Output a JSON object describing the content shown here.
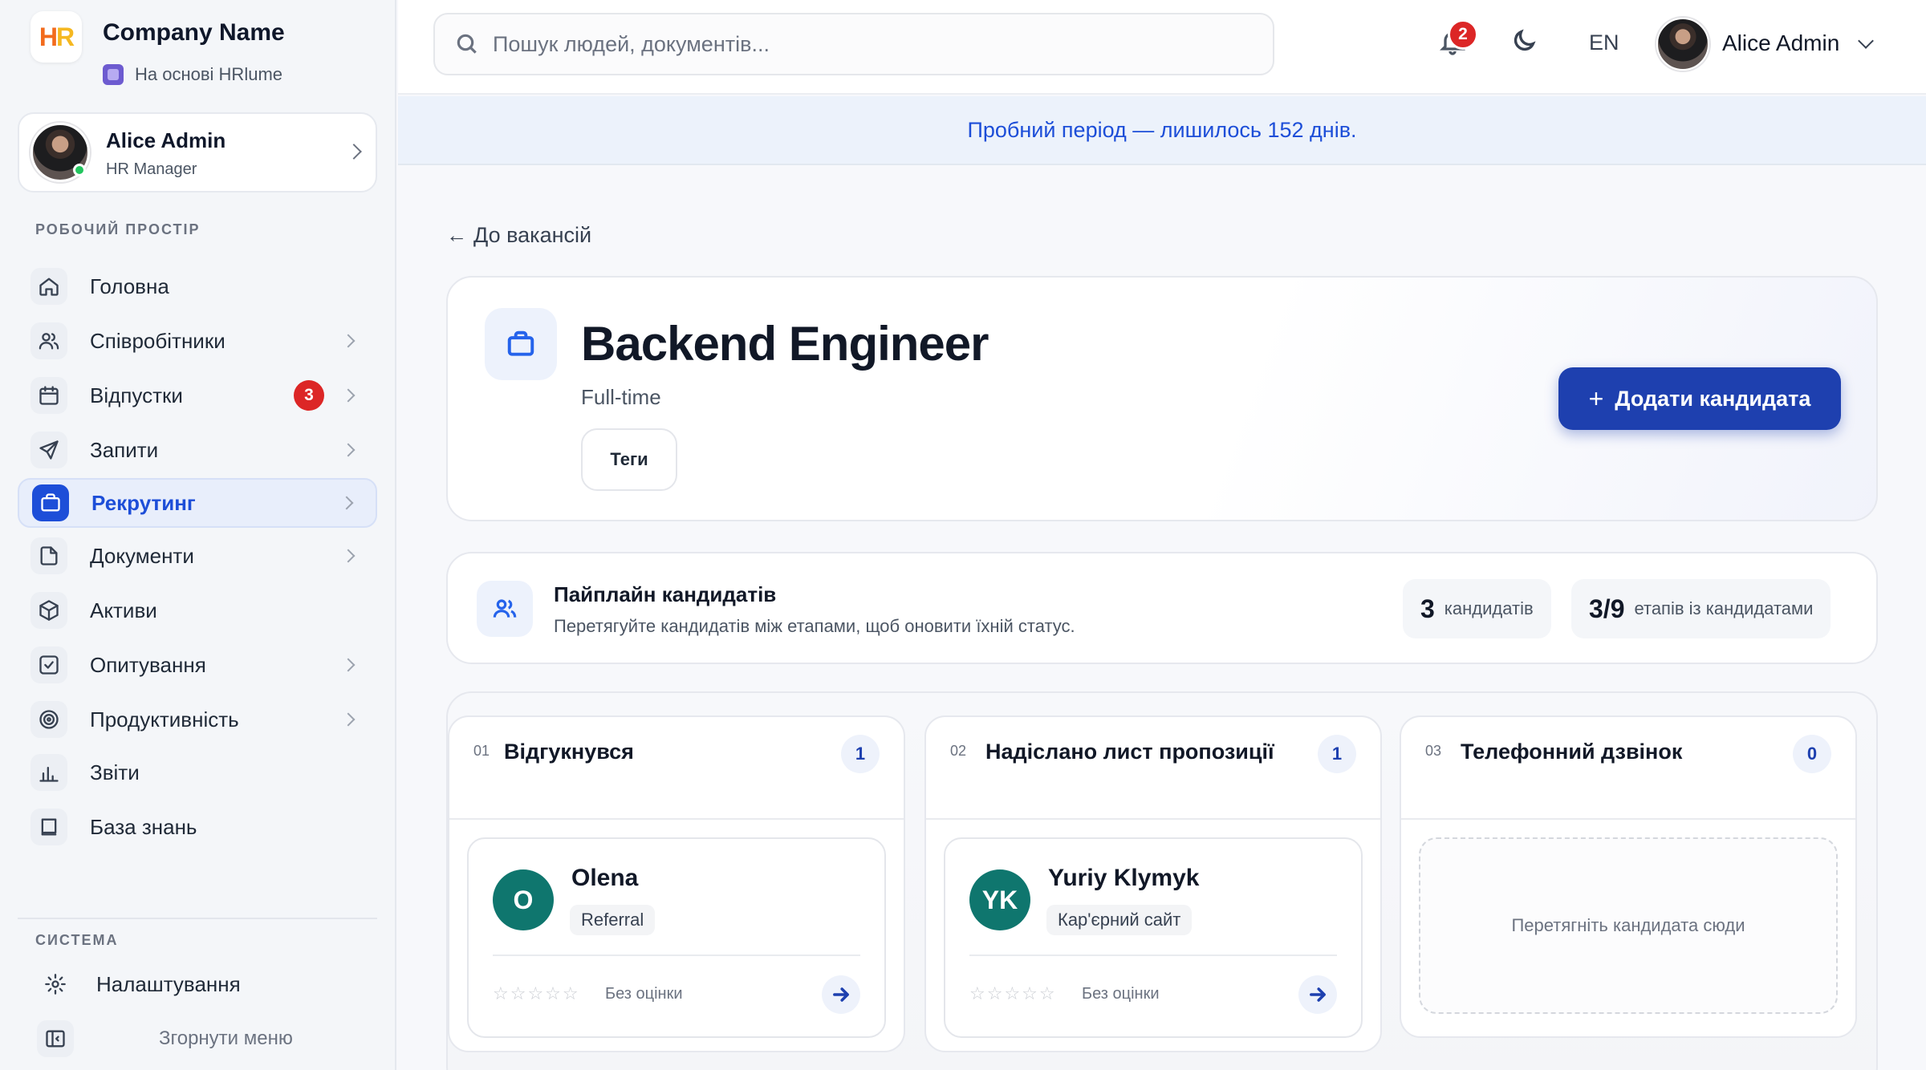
{
  "brand": {
    "logo_h": "H",
    "logo_r": "R",
    "name": "Company Name",
    "powered_by": "На основі HRlume"
  },
  "user": {
    "name": "Alice Admin",
    "role": "HR Manager"
  },
  "sidebar": {
    "workspace_label": "РОБОЧИЙ ПРОСТІР",
    "items": [
      {
        "label": "Головна",
        "icon": "home-icon"
      },
      {
        "label": "Співробітники",
        "icon": "users-icon"
      },
      {
        "label": "Відпустки",
        "icon": "calendar-icon",
        "badge": "3"
      },
      {
        "label": "Запити",
        "icon": "send-icon"
      },
      {
        "label": "Рекрутинг",
        "icon": "briefcase-icon"
      },
      {
        "label": "Документи",
        "icon": "file-icon"
      },
      {
        "label": "Активи",
        "icon": "box-icon"
      },
      {
        "label": "Опитування",
        "icon": "checkbox-icon"
      },
      {
        "label": "Продуктивність",
        "icon": "target-icon"
      },
      {
        "label": "Звіти",
        "icon": "bar-chart-icon"
      },
      {
        "label": "База знань",
        "icon": "book-icon"
      }
    ],
    "system_label": "СИСТЕМА",
    "settings_label": "Налаштування",
    "collapse_label": "Згорнути меню"
  },
  "topbar": {
    "search_placeholder": "Пошук людей, документів...",
    "notifications_count": "2",
    "language": "EN",
    "user_name": "Alice Admin"
  },
  "trial_banner": "Пробний період — лишилось 152 днів.",
  "back_link": "До вакансій",
  "job": {
    "title": "Backend Engineer",
    "type": "Full-time",
    "tags_label": "Теги",
    "add_candidate_label": "Додати кандидата"
  },
  "pipeline": {
    "title": "Пайплайн кандидатів",
    "subtitle": "Перетягуйте кандидатів між етапами, щоб оновити їхній статус.",
    "candidates_count": "3",
    "candidates_label": "кандидатів",
    "stages_count": "3/9",
    "stages_label": "етапів із кандидатами"
  },
  "stages": [
    {
      "number": "01",
      "name": "Відгукнувся",
      "count": "1",
      "candidate": {
        "initials": "O",
        "name": "Olena",
        "source": "Referral",
        "stars": "☆☆☆☆☆",
        "rating": "Без оцінки"
      }
    },
    {
      "number": "02",
      "name": "Надіслано лист пропозиції",
      "count": "1",
      "candidate": {
        "initials": "YK",
        "name": "Yuriy Klymyk",
        "source": "Кар'єрний сайт",
        "stars": "☆☆☆☆☆",
        "rating": "Без оцінки"
      }
    },
    {
      "number": "03",
      "name": "Телефонний дзвінок",
      "count": "0",
      "dropzone": "Перетягніть кандидата сюди"
    }
  ]
}
